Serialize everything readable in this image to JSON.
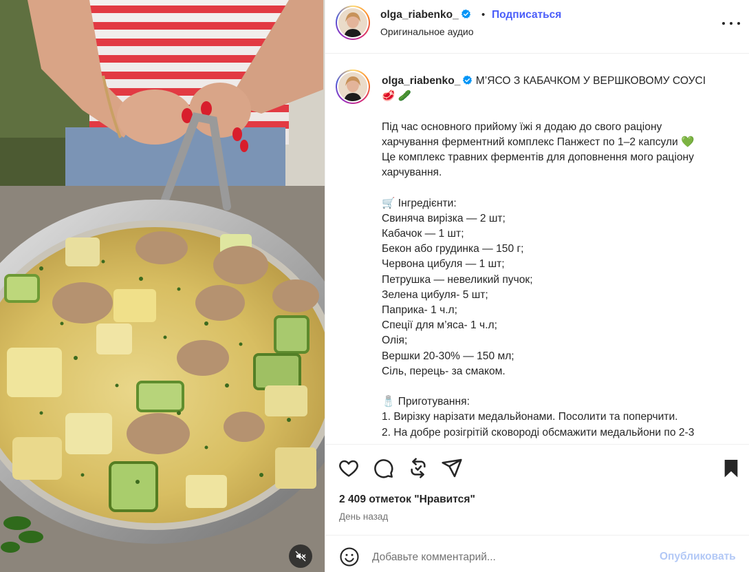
{
  "post": {
    "username": "olga_riabenko_",
    "follow_label": "Подписаться",
    "separator": "•",
    "audio_label": "Оригинальное аудио",
    "more_icon": "more-horizontal-icon",
    "verified_icon": "verified-badge-icon"
  },
  "caption": {
    "username": "olga_riabenko_",
    "title": "М’ЯСО З КАБАЧКОМ У ВЕРШКОВОМУ СОУСІ",
    "title_emojis": "🥩 🥒",
    "intro": [
      "Під час основного прийому їжі я додаю до свого раціону",
      "харчування ферментний комплекс Панжест по 1–2 капсули 💚",
      "Це комплекс травних ферментів для доповнення мого раціону",
      "харчування."
    ],
    "ingredients_heading": "🛒 Інгредієнти:",
    "ingredients": [
      "Свиняча вирізка — 2 шт;",
      "Кабачок — 1 шт;",
      "Бекон або грудинка — 150 г;",
      "Червона цибуля — 1 шт;",
      "Петрушка — невеликий пучок;",
      "Зелена цибуля- 5 шт;",
      "Паприка- 1 ч.л;",
      "Спеції для м’яса- 1 ч.л;",
      "Олія;",
      "Вершки 20-30% — 150 мл;",
      "Сіль, перець- за смаком."
    ],
    "cooking_heading": "🧂 Приготування:",
    "steps": [
      "1. Вирізку нарізати медальйонами. Посолити та поперчити.",
      "2. На добре розігрітій сковороді обсмажити медальйони по 2-3"
    ]
  },
  "actions": {
    "icons": [
      "heart-icon",
      "comment-icon",
      "repost-icon",
      "share-icon",
      "bookmark-icon"
    ],
    "likes": "2 409 отметок \"Нравится\"",
    "time": "День назад"
  },
  "comment": {
    "placeholder": "Добавьте комментарий...",
    "publish_label": "Опубликовать"
  },
  "media": {
    "mute_icon": "sound-off-icon"
  },
  "colors": {
    "link_blue": "#4a5df9",
    "publish_disabled": "#b2c8f6",
    "secondary_text": "#737373",
    "verified_blue": "#0095f6"
  }
}
